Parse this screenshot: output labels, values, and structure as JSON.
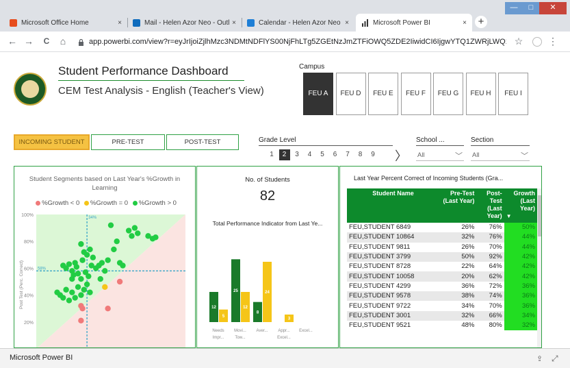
{
  "browser": {
    "tabs": [
      {
        "label": "Microsoft Office Home",
        "color": "#e74c1c"
      },
      {
        "label": "Mail - Helen Azor Neo - Outlook",
        "color": "#0f6cbd"
      },
      {
        "label": "Calendar - Helen Azor Neo - Out",
        "color": "#1e7fd6"
      },
      {
        "label": "Microsoft Power BI",
        "color": "#333333"
      }
    ],
    "close_glyph": "×",
    "new_tab": "+",
    "url": "app.powerbi.com/view?r=eyJrIjoiZjlhMzc3NDMtNDFlYS00NjFhLTg5ZGEtNzJmZTFiOWQ5ZDE2IiwidCI6IjgwYTQ1ZWRjLWQ1ZWUtNDZlMC0...",
    "nav": {
      "back": "←",
      "forward": "→",
      "reload": "C",
      "home": "⌂"
    },
    "star": "☆",
    "menu": "⋮",
    "window_controls": {
      "minimize": "—",
      "maximize": "□",
      "close": "✕"
    }
  },
  "dashboard": {
    "title": "Student Performance Dashboard",
    "subtitle": "CEM Test Analysis - English (Teacher's View)",
    "campus_label": "Campus",
    "campuses": [
      "FEU A",
      "FEU D",
      "FEU E",
      "FEU F",
      "FEU G",
      "FEU H",
      "FEU I"
    ],
    "selected_campus": "FEU A",
    "tests": [
      "INCOMING STUDENT",
      "PRE-TEST",
      "POST-TEST"
    ],
    "selected_test": "INCOMING STUDENT",
    "grade_label": "Grade Level",
    "grades": [
      "1",
      "2",
      "3",
      "4",
      "5",
      "6",
      "7",
      "8",
      "9"
    ],
    "selected_grade": "2",
    "grade_next": "〉",
    "school_label": "School ...",
    "school_value": "All",
    "section_label": "Section",
    "section_value": "All",
    "dropdown_arrow": "﹀"
  },
  "segments_panel": {
    "title_line1": "Student Segments based on Last Year's %Growth in",
    "title_line2": "Learning",
    "legend": [
      {
        "label": "%Growth < 0",
        "color": "#f07a7a"
      },
      {
        "label": "%Growth = 0",
        "color": "#f5c518"
      },
      {
        "label": "%Growth > 0",
        "color": "#22cc44"
      }
    ]
  },
  "students_panel": {
    "title": "No. of Students",
    "count": "82",
    "subtitle": "Total Performance Indicator from Last Ye..."
  },
  "table_panel": {
    "title": "Last Year Percent Correct of Incoming Students (Gra...",
    "headers": [
      "Student Name",
      "Pre-Test (Last Year)",
      "Post-Test (Last Year)",
      "Growth (Last Year)"
    ],
    "sort_glyph": "▼",
    "rows": [
      {
        "name": "FEU,STUDENT 6849",
        "pre": "26%",
        "post": "76%",
        "growth": "50%"
      },
      {
        "name": "FEU,STUDENT 10864",
        "pre": "32%",
        "post": "76%",
        "growth": "44%"
      },
      {
        "name": "FEU,STUDENT 9811",
        "pre": "26%",
        "post": "70%",
        "growth": "44%"
      },
      {
        "name": "FEU,STUDENT 3799",
        "pre": "50%",
        "post": "92%",
        "growth": "42%"
      },
      {
        "name": "FEU,STUDENT 8728",
        "pre": "22%",
        "post": "64%",
        "growth": "42%"
      },
      {
        "name": "FEU,STUDENT 10058",
        "pre": "20%",
        "post": "62%",
        "growth": "42%"
      },
      {
        "name": "FEU,STUDENT 4299",
        "pre": "36%",
        "post": "72%",
        "growth": "36%"
      },
      {
        "name": "FEU,STUDENT 9578",
        "pre": "38%",
        "post": "74%",
        "growth": "36%"
      },
      {
        "name": "FEU,STUDENT 9722",
        "pre": "34%",
        "post": "70%",
        "growth": "36%"
      },
      {
        "name": "FEU,STUDENT 3001",
        "pre": "32%",
        "post": "66%",
        "growth": "34%"
      },
      {
        "name": "FEU,STUDENT 9521",
        "pre": "48%",
        "post": "80%",
        "growth": "32%"
      }
    ]
  },
  "statusbar": {
    "label": "Microsoft Power BI",
    "share_glyph": "⇪",
    "fullscreen_glyph": "⤢"
  },
  "chart_data": [
    {
      "type": "scatter",
      "ylabel": "Post Test (Perc. Correct)",
      "ylim": [
        0,
        100
      ],
      "yticks": [
        "100%",
        "80%",
        "60%",
        "40%",
        "20%"
      ],
      "reference_labels": {
        "x_mean": "34%",
        "y_mean": "58%"
      },
      "x_mean": 34,
      "y_mean": 58,
      "series": [
        {
          "name": "%Growth > 0",
          "color": "#22cc44",
          "points": [
            [
              18,
              62
            ],
            [
              20,
              60
            ],
            [
              22,
              63
            ],
            [
              24,
              58
            ],
            [
              25,
              55
            ],
            [
              26,
              64
            ],
            [
              27,
              61
            ],
            [
              28,
              56
            ],
            [
              30,
              52
            ],
            [
              31,
              66
            ],
            [
              32,
              72
            ],
            [
              33,
              57
            ],
            [
              34,
              70
            ],
            [
              35,
              54
            ],
            [
              36,
              74
            ],
            [
              37,
              62
            ],
            [
              38,
              68
            ],
            [
              40,
              60
            ],
            [
              42,
              62
            ],
            [
              43,
              52
            ],
            [
              44,
              64
            ],
            [
              46,
              58
            ],
            [
              48,
              66
            ],
            [
              50,
              92
            ],
            [
              52,
              74
            ],
            [
              54,
              80
            ],
            [
              56,
              64
            ],
            [
              58,
              62
            ],
            [
              62,
              88
            ],
            [
              64,
              84
            ],
            [
              66,
              90
            ],
            [
              68,
              86
            ],
            [
              75,
              84
            ],
            [
              78,
              82
            ],
            [
              80,
              83
            ],
            [
              14,
              42
            ],
            [
              16,
              40
            ],
            [
              18,
              38
            ],
            [
              20,
              44
            ],
            [
              22,
              36
            ],
            [
              24,
              42
            ],
            [
              26,
              38
            ],
            [
              28,
              46
            ],
            [
              30,
              40
            ],
            [
              32,
              44
            ],
            [
              34,
              48
            ],
            [
              36,
              42
            ],
            [
              24,
              52
            ],
            [
              30,
              78
            ]
          ]
        },
        {
          "name": "%Growth = 0",
          "color": "#f5c518",
          "points": [
            [
              46,
              46
            ]
          ]
        },
        {
          "name": "%Growth < 0",
          "color": "#f07a7a",
          "points": [
            [
              30,
              32
            ],
            [
              31,
              30
            ],
            [
              30,
              21
            ],
            [
              48,
              30
            ],
            [
              56,
              50
            ]
          ]
        }
      ]
    },
    {
      "type": "bar",
      "title": "Total Performance Indicator from Last Ye...",
      "categories": [
        [
          "Needs",
          "Impr..."
        ],
        [
          "Movi...",
          "Tow..."
        ],
        [
          "Aver...",
          ""
        ],
        [
          "Appr...",
          "Excel..."
        ],
        [
          "Excel...",
          ""
        ]
      ],
      "series": [
        {
          "color": "#1a7a2a",
          "values": [
            12,
            25,
            8,
            0,
            0
          ]
        },
        {
          "color": "#f5c518",
          "values": [
            5,
            12,
            24,
            3,
            0
          ]
        }
      ],
      "ylim": [
        0,
        30
      ]
    }
  ]
}
